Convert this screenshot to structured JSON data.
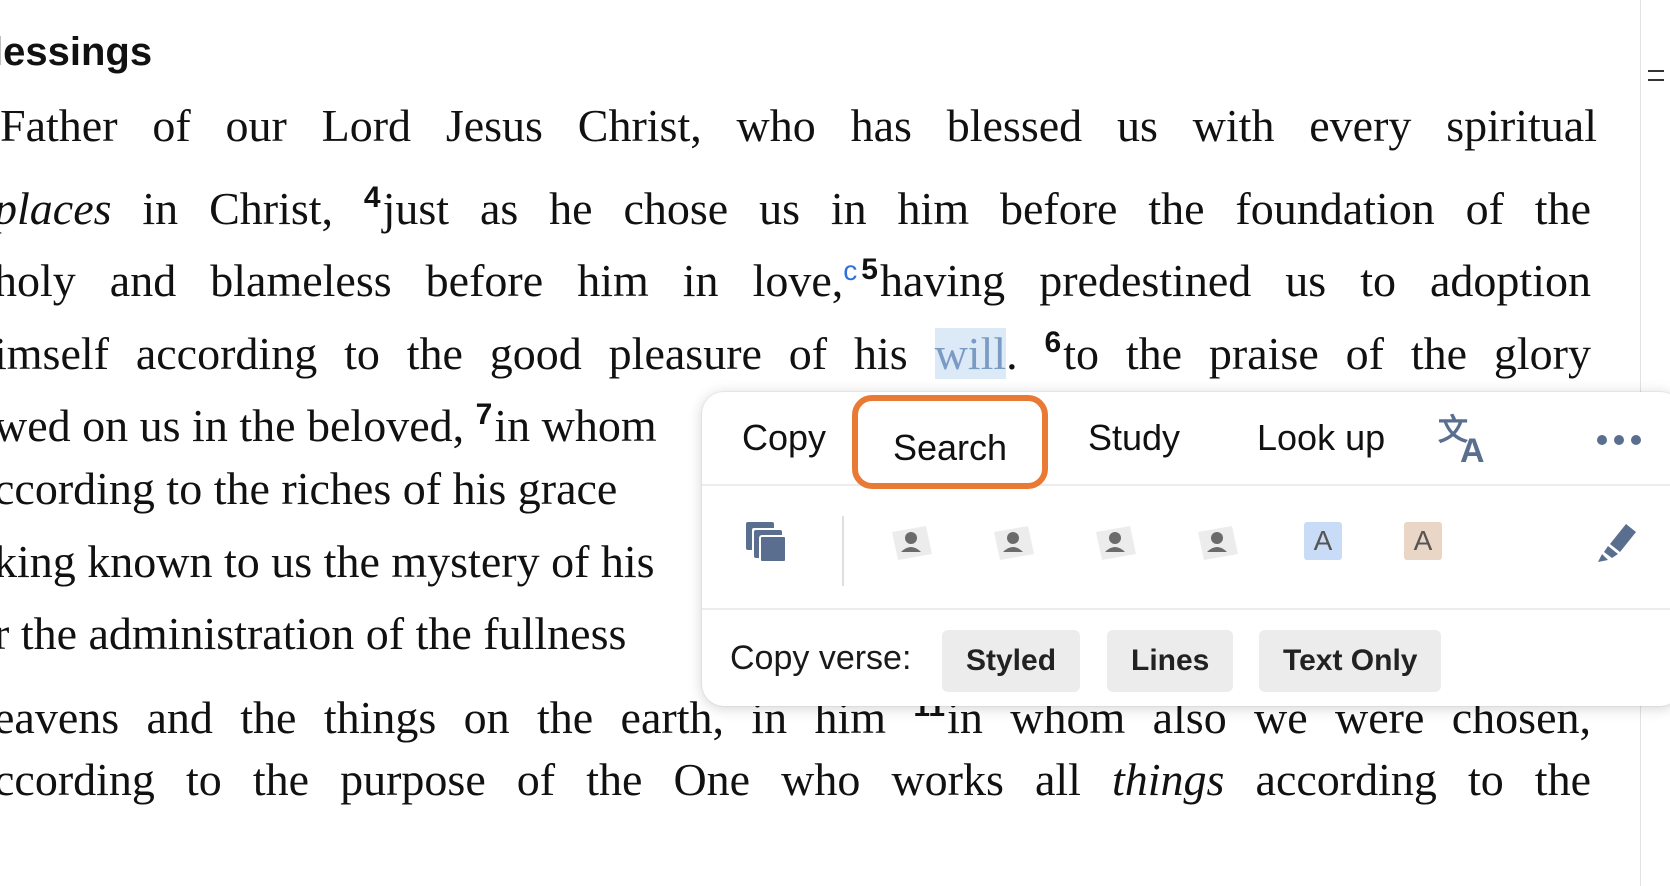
{
  "passage": {
    "heading": "lessings",
    "lines": [
      {
        "segments": [
          {
            "t": " Father of our Lord Jesus Christ, who has blessed us with every spiritual"
          }
        ]
      },
      {
        "segments": [
          {
            "t": "places",
            "style": "italic"
          },
          {
            "t": " in Christ, "
          },
          {
            "t": "4",
            "style": "verse"
          },
          {
            "t": "just as he chose us in him before the foundation of the"
          }
        ]
      },
      {
        "segments": [
          {
            "t": "holy and blameless before him in love,"
          },
          {
            "t": "c",
            "style": "footnote"
          },
          {
            "t": "5",
            "style": "verse"
          },
          {
            "t": "having predestined us to adoption"
          }
        ]
      },
      {
        "segments": [
          {
            "t": "imself according to the good pleasure of his "
          },
          {
            "t": "will",
            "style": "selected"
          },
          {
            "t": ". "
          },
          {
            "t": "6",
            "style": "verse"
          },
          {
            "t": "to the praise of the glory"
          }
        ]
      },
      {
        "segments": [
          {
            "t": "wed on us in the beloved, "
          },
          {
            "t": "7",
            "style": "verse"
          },
          {
            "t": "in whom"
          }
        ]
      },
      {
        "segments": [
          {
            "t": "ccording to the riches of his grace"
          }
        ]
      },
      {
        "segments": [
          {
            "t": "king known to us the mystery of his"
          }
        ]
      },
      {
        "segments": [
          {
            "t": "r the administration of the fullness"
          }
        ]
      },
      {
        "segments": [
          {
            "t": "eavens and the things on the earth, in him "
          },
          {
            "t": "11",
            "style": "verse"
          },
          {
            "t": "in whom also we were chosen,"
          }
        ]
      },
      {
        "segments": [
          {
            "t": "ccording to the purpose of the One who works all "
          },
          {
            "t": "things",
            "style": "italic"
          },
          {
            "t": " according to the"
          }
        ]
      }
    ]
  },
  "popup": {
    "actions": {
      "copy": "Copy",
      "search": "Search",
      "study": "Study",
      "look_up": "Look up"
    },
    "icons": {
      "translate": "translate-icon",
      "more": "more-icon",
      "copy_multiple": "copy-multiple-icon",
      "highlighter": "highlighter-icon"
    },
    "highlight_styles": [
      {
        "name": "tag-style-1",
        "icon": "person-tag-icon"
      },
      {
        "name": "tag-style-2",
        "icon": "person-tag-icon"
      },
      {
        "name": "tag-style-3",
        "icon": "person-tag-icon"
      },
      {
        "name": "tag-style-4",
        "icon": "person-tag-icon"
      },
      {
        "name": "highlight-blue",
        "letter": "A",
        "color": "#c9dcf7"
      },
      {
        "name": "highlight-tan",
        "letter": "A",
        "color": "#ead6c6"
      }
    ],
    "copy_verse": {
      "label": "Copy verse:",
      "options": {
        "styled": "Styled",
        "lines": "Lines",
        "text_only": "Text Only"
      }
    },
    "accent_color": "#e87a35"
  }
}
